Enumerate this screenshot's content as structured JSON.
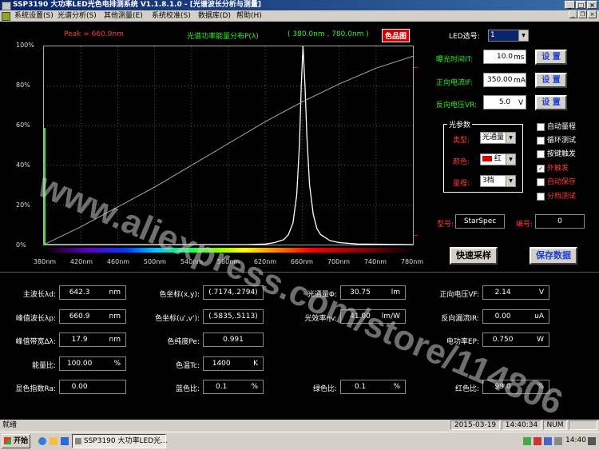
{
  "window": {
    "title": "SSP3190 大功率LED光色电排测系统 V1.1.8.1.0 - [光谱波长分析与测量]",
    "buttons": [
      "_",
      "□",
      "×"
    ]
  },
  "menu": [
    "系统设置(S)",
    "光谱分析(S)",
    "其他测量(E)",
    "系统校准(S)",
    "数据库(D)",
    "帮助(H)"
  ],
  "chart_header": {
    "peak": "Peak = 660.9nm",
    "title": "光谱功率能量分布P(λ)",
    "range": "( 380.0nm , 780.0nm )",
    "color_button": "色品图"
  },
  "chart_data": {
    "type": "line",
    "xlabel": "",
    "ylabel": "",
    "xlim": [
      380,
      780
    ],
    "ylim": [
      0,
      100
    ],
    "x_ticks": [
      "380nm",
      "420nm",
      "460nm",
      "500nm",
      "540nm",
      "580nm",
      "620nm",
      "660nm",
      "700nm",
      "740nm",
      "780nm"
    ],
    "y_ticks": [
      "100%",
      "80%",
      "60%",
      "40%",
      "20%",
      "0%"
    ],
    "peak_nm": 660.9,
    "series": [
      {
        "color": "#ffffff",
        "x": [
          380,
          500,
          600,
          620,
          630,
          640,
          645,
          650,
          654,
          657,
          659,
          660.9,
          663,
          665,
          668,
          672,
          676,
          680,
          690,
          700,
          720,
          780
        ],
        "y": [
          0,
          0,
          0,
          0.3,
          1,
          2.5,
          5,
          11,
          25,
          50,
          80,
          100,
          80,
          55,
          30,
          15,
          8,
          5,
          2,
          1,
          0.3,
          0
        ]
      },
      {
        "color": "#aaaaaa",
        "x": [
          380,
          420,
          460,
          500,
          540,
          580,
          620,
          660,
          700,
          740,
          780
        ],
        "y": [
          0,
          9,
          19,
          29,
          40,
          51,
          62,
          72,
          81,
          89,
          95
        ]
      }
    ]
  },
  "right_panel": {
    "led_label": "LED选号:",
    "led_value": "1",
    "exposure_label": "曝光时间IT:",
    "exposure_value": "10.0",
    "exposure_unit": "ms",
    "current_label": "正向电流IF:",
    "current_value": "350.00",
    "current_unit": "mA",
    "voltage_label": "反向电压VR:",
    "voltage_value": "5.0",
    "voltage_unit": "V",
    "set_button": "设 置",
    "group_title": "光参数",
    "type_label": "类型:",
    "type_value": "光通量",
    "color_label": "颜色:",
    "color_value": "红",
    "range_label": "量程:",
    "range_value": "3档",
    "checkboxes": [
      {
        "label": "自动量程",
        "checked": false
      },
      {
        "label": "循环测试",
        "checked": false
      },
      {
        "label": "按键触发",
        "checked": false
      },
      {
        "label": "外触发",
        "checked": true
      },
      {
        "label": "自动保存",
        "checked": false
      },
      {
        "label": "分档测试",
        "checked": false
      }
    ],
    "model_label": "型号:",
    "model_value": "StarSpec",
    "number_label": "编号:",
    "number_value": "0",
    "quick_button": "快速采样",
    "save_button": "保存数据"
  },
  "results": [
    {
      "label": "主波长λd:",
      "value": "642.3",
      "unit": "nm"
    },
    {
      "label": "峰值波长λp:",
      "value": "660.9",
      "unit": "nm"
    },
    {
      "label": "峰值带宽Δλ:",
      "value": "17.9",
      "unit": "nm"
    },
    {
      "label": "能量比:",
      "value": "100.00",
      "unit": "%"
    },
    {
      "label": "显色指数Ra:",
      "value": "0.00",
      "unit": ""
    },
    {
      "label": "色坐标(x,y):",
      "value": "(.7174,.2794)",
      "unit": ""
    },
    {
      "label": "色坐标(u',v'):",
      "value": "(.5835,.5113)",
      "unit": ""
    },
    {
      "label": "色纯度Pe:",
      "value": "0.991",
      "unit": ""
    },
    {
      "label": "色温Tc:",
      "value": "1400",
      "unit": "K"
    },
    {
      "label": "蓝色比:",
      "value": "0.1",
      "unit": "%"
    },
    {
      "label": "光通量Φ:",
      "value": "30.75",
      "unit": "lm"
    },
    {
      "label": "光效率ηv:",
      "value": "41.00",
      "unit": "lm/W"
    },
    {
      "label": "绿色比:",
      "value": "0.1",
      "unit": "%"
    },
    {
      "label": "正向电压VF:",
      "value": "2.14",
      "unit": "V"
    },
    {
      "label": "反向漏流IR:",
      "value": "0.00",
      "unit": "uA"
    },
    {
      "label": "电功率EP:",
      "value": "0.750",
      "unit": "W"
    },
    {
      "label": "红色比:",
      "value": "99.0",
      "unit": "%"
    }
  ],
  "watermark": "www.aliexpress.com/store/114806",
  "status": {
    "ready": "就绪",
    "date": "2015-03-19",
    "time": "14:40:34",
    "num": "NUM"
  },
  "taskbar": {
    "start": "开始",
    "task": "SSP3190 大功率LED光...",
    "clock": "14:40"
  },
  "colors": {
    "label_green": "#2ef02e",
    "peak_red": "#ff3b3b",
    "set_button_text": "#1a3fd6"
  }
}
